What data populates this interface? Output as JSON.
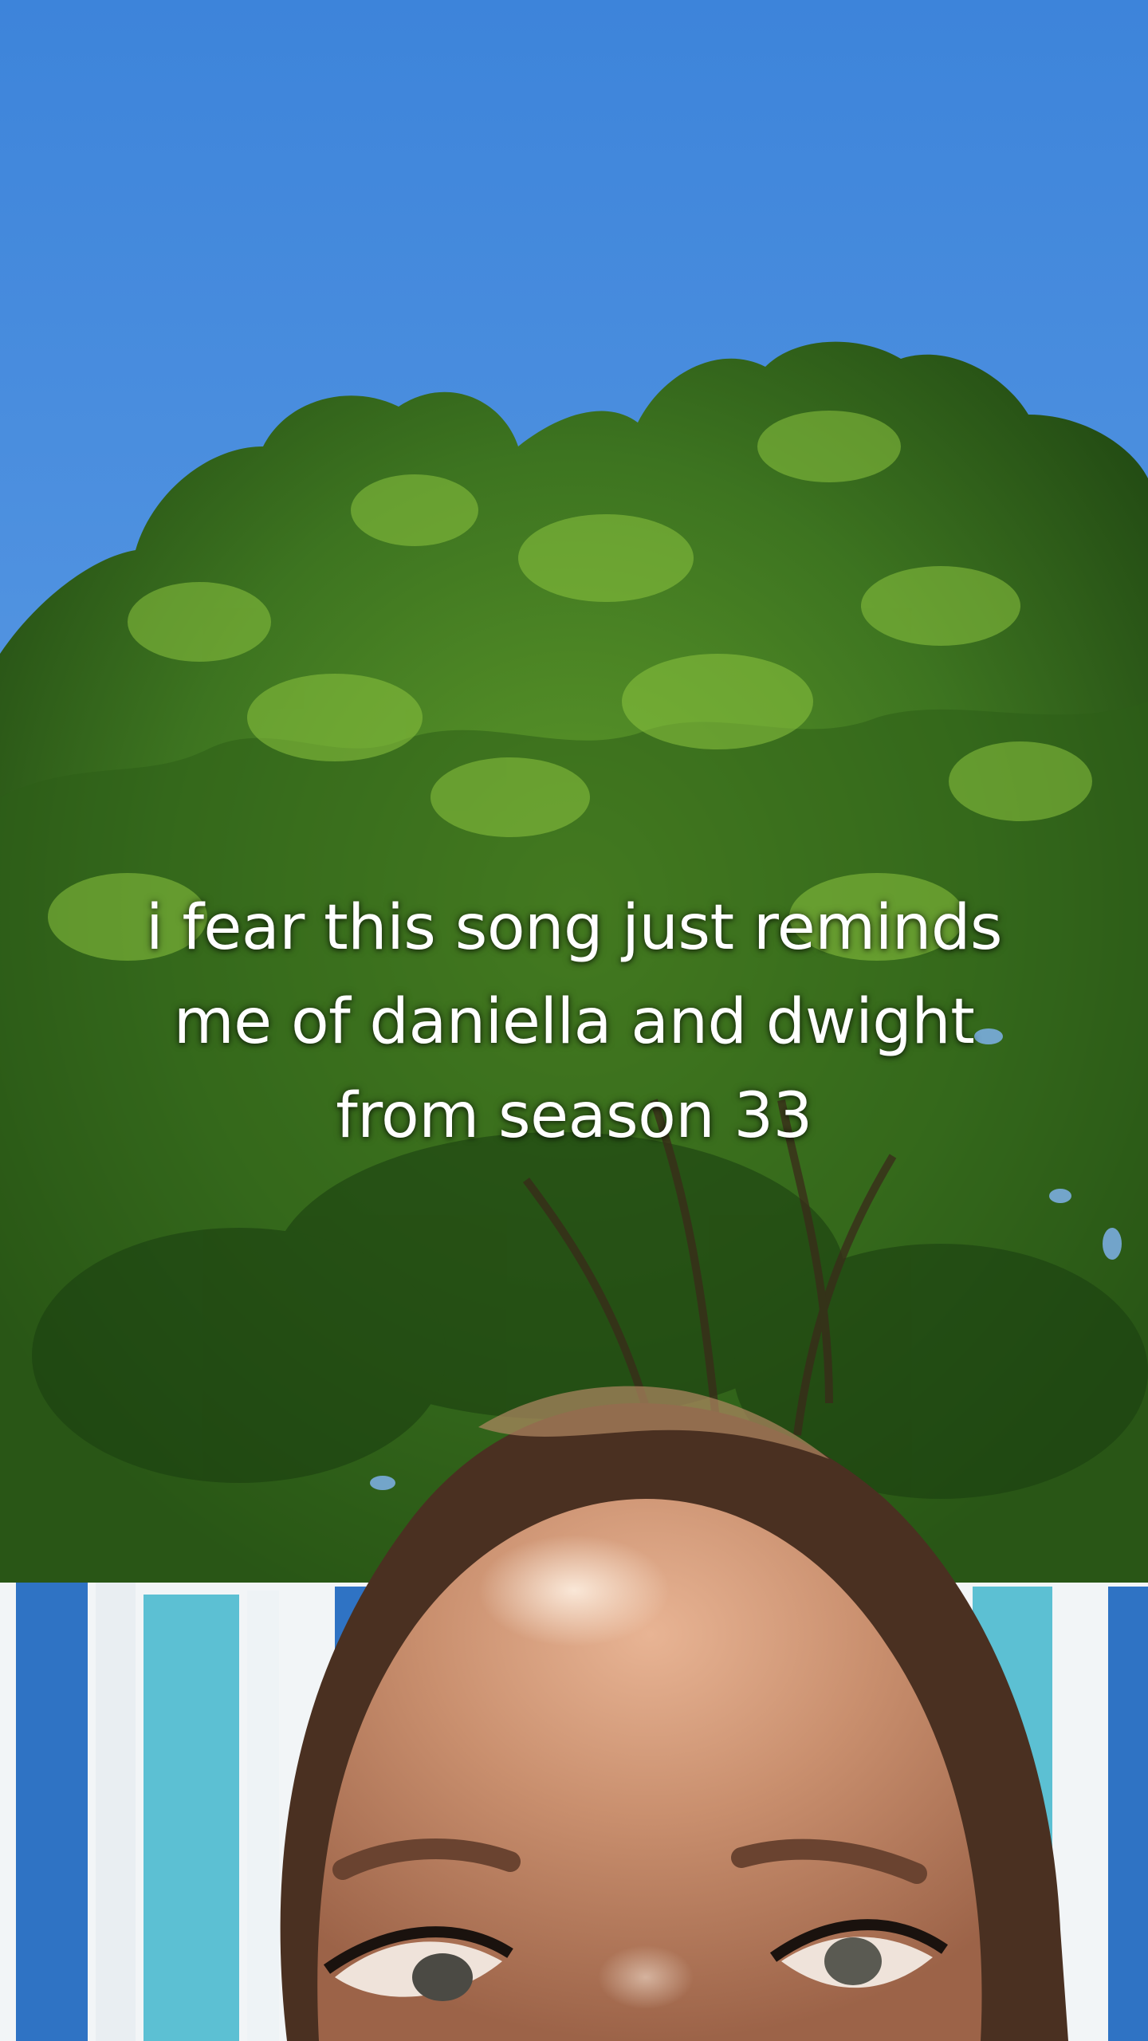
{
  "caption": {
    "lines": [
      "i fear this song just reminds",
      "me of daniella and dwight",
      "from season 33"
    ]
  },
  "colors": {
    "sky_top": "#3f86dc",
    "sky_bottom": "#7db3ee",
    "foliage_dark": "#1f4a14",
    "foliage_mid": "#3f7a22",
    "foliage_light": "#7fb83a",
    "towel_blue": "#2f73c4",
    "towel_aqua": "#5cc0d3",
    "towel_white": "#f2f5f7",
    "skin": "#c58a6a",
    "hair": "#5a3b28"
  }
}
